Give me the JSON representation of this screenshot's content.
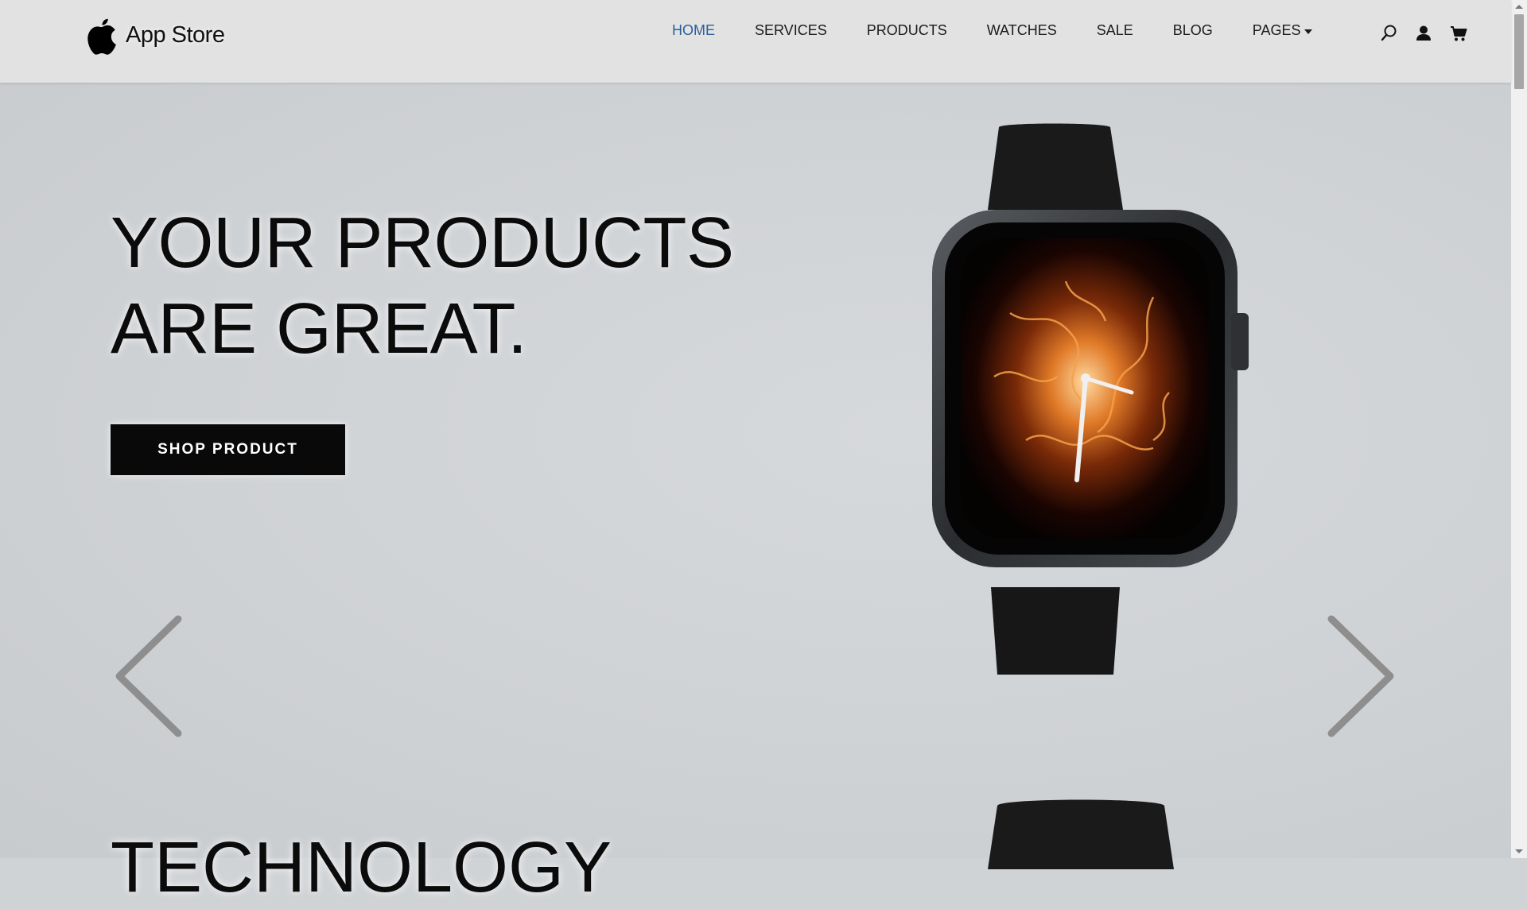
{
  "brand": {
    "name": "App Store",
    "logo_icon": "apple-logo-icon"
  },
  "nav": {
    "items": [
      {
        "label": "HOME",
        "active": true
      },
      {
        "label": "SERVICES"
      },
      {
        "label": "PRODUCTS"
      },
      {
        "label": "WATCHES"
      },
      {
        "label": "SALE"
      },
      {
        "label": "BLOG"
      },
      {
        "label": "PAGES",
        "has_dropdown": true
      }
    ],
    "icons": [
      "search-icon",
      "user-icon",
      "cart-icon"
    ],
    "active_color": "#2b5f9e"
  },
  "hero": {
    "title_line1": "YOUR PRODUCTS",
    "title_line2": "ARE GREAT.",
    "button_label": "SHOP PRODUCT",
    "prev_icon": "chevron-left-icon",
    "next_icon": "chevron-right-icon",
    "image": "smartwatch-image"
  },
  "next_slide": {
    "title": "TECHNOLOGY"
  },
  "colors": {
    "background": "#d0d3d6",
    "navbar": "#e2e2e2",
    "button": "#090909"
  }
}
